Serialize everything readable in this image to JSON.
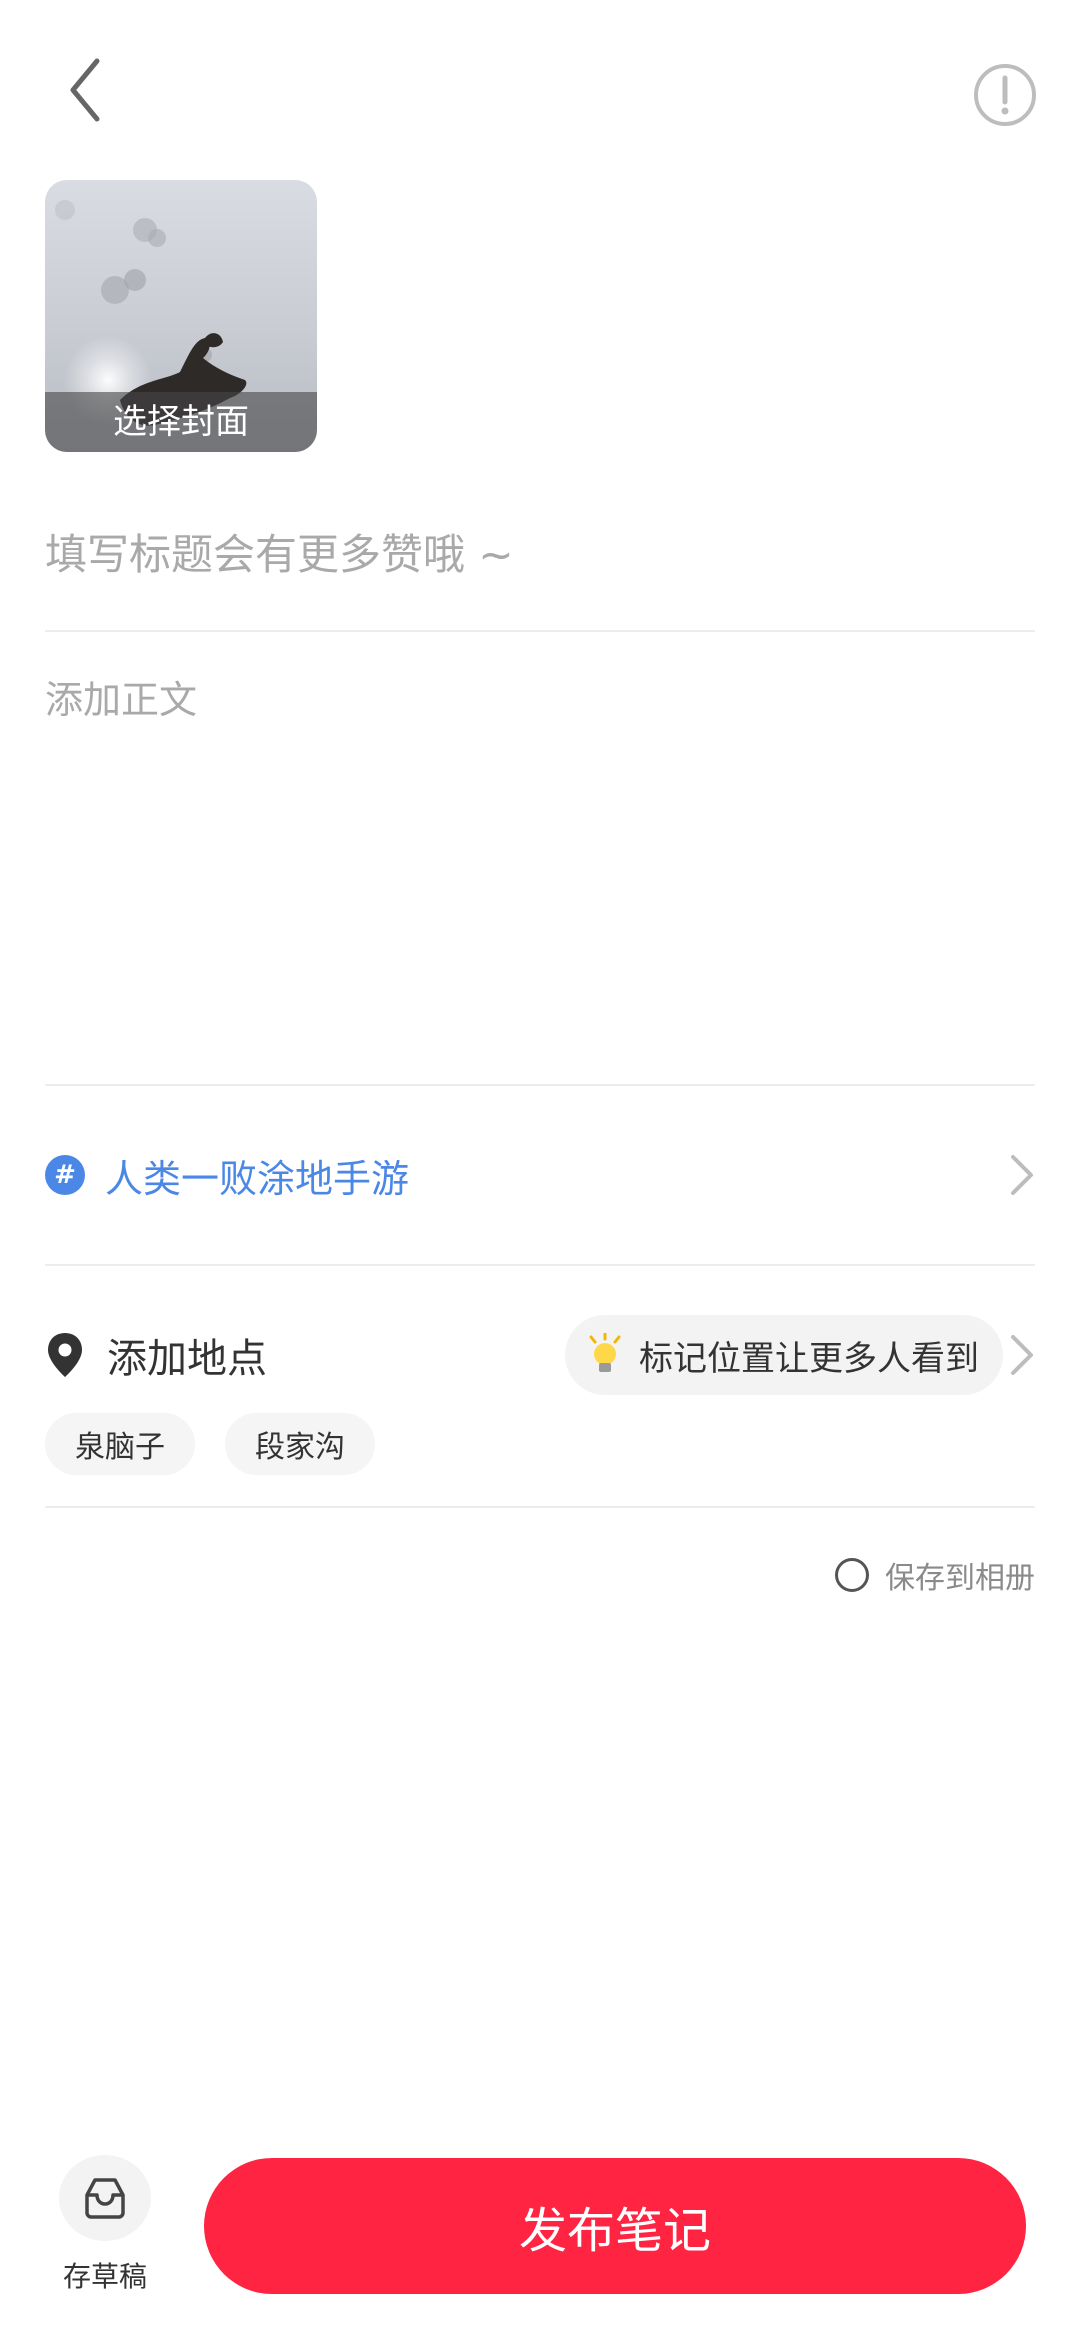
{
  "cover": {
    "caption": "选择封面"
  },
  "title": {
    "placeholder": "填写标题会有更多赞哦 ~"
  },
  "body": {
    "placeholder": "添加正文"
  },
  "topic": {
    "icon": "hash-icon",
    "label": "人类一败涂地手游"
  },
  "location": {
    "icon": "location-pin-icon",
    "label": "添加地点",
    "hint": "标记位置让更多人看到",
    "suggestions": [
      "泉脑子",
      "段家沟"
    ]
  },
  "save_album": {
    "label": "保存到相册",
    "checked": false
  },
  "bottom": {
    "draft_label": "存草稿",
    "publish_label": "发布笔记"
  },
  "colors": {
    "accent": "#ff2442",
    "topic": "#4a87e6"
  }
}
